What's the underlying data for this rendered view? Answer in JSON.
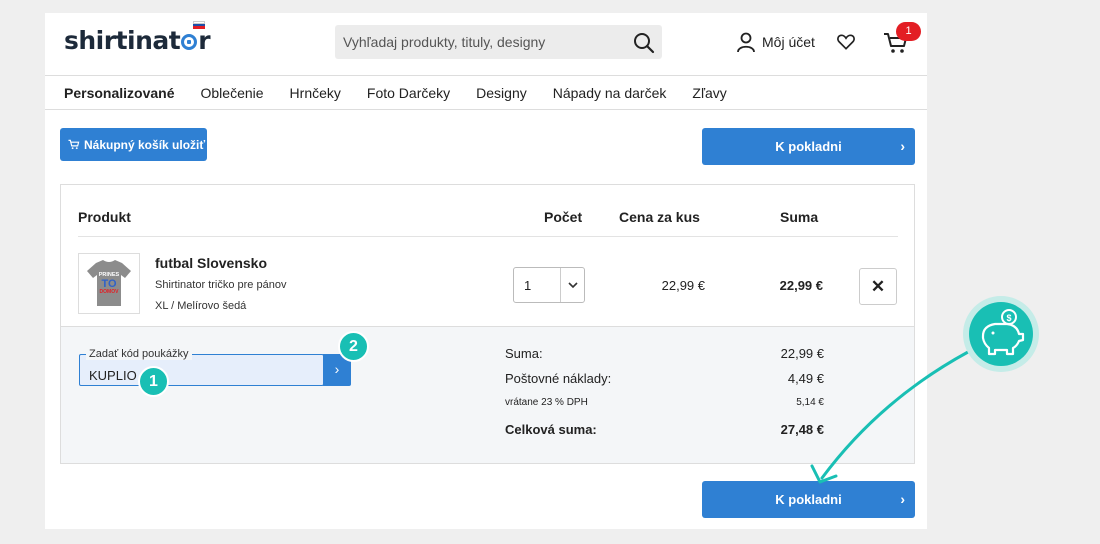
{
  "header": {
    "logo_text": "shirtinator",
    "search_placeholder": "Vyhľadaj produkty, tituly, designy",
    "account_label": "Môj účet",
    "cart_count": "1"
  },
  "nav": {
    "items": [
      "Personalizované",
      "Oblečenie",
      "Hrnčeky",
      "Foto Darčeky",
      "Designy",
      "Nápady na darček",
      "Zľavy"
    ]
  },
  "actions": {
    "save_cart_label": "Nákupný košík uložiť",
    "checkout_label": "K pokladni"
  },
  "table": {
    "headers": {
      "product": "Produkt",
      "quantity": "Počet",
      "unit_price": "Cena za kus",
      "sum": "Suma"
    },
    "item": {
      "name": "futbal Slovensko",
      "description": "Shirtinator tričko pre pánov",
      "variant": "XL / Melírovo šedá",
      "quantity": "1",
      "unit_price": "22,99 €",
      "sum": "22,99 €",
      "thumb_text_1": "PRINES",
      "thumb_text_2": "TO",
      "thumb_text_3": "DOMOV"
    }
  },
  "voucher": {
    "label": "Zadať kód poukážky",
    "value": "KUPLIO",
    "marker_1": "1",
    "marker_2": "2"
  },
  "totals": {
    "subtotal_label": "Suma:",
    "subtotal_value": "22,99 €",
    "shipping_label": "Poštovné náklady:",
    "shipping_value": "4,49 €",
    "vat_label": "vrátane 23 % DPH",
    "vat_value": "5,14 €",
    "total_label": "Celková suma:",
    "total_value": "27,48 €"
  },
  "colors": {
    "accent_blue": "#2f80d3",
    "badge_red": "#e31e24",
    "annotation_teal": "#19bfb4"
  },
  "icons": [
    "search-icon",
    "user-icon",
    "heart-icon",
    "cart-icon",
    "chevron-right-icon",
    "chevron-down-icon",
    "close-icon",
    "piggy-bank-icon"
  ]
}
